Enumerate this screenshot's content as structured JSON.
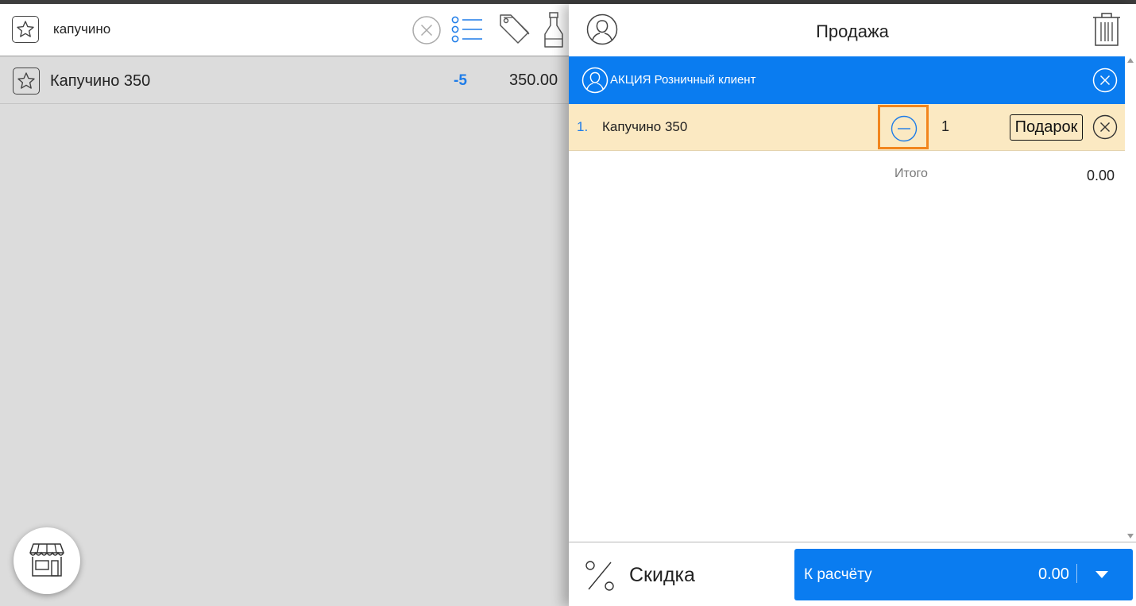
{
  "search": {
    "query": "капучино",
    "icons": [
      "star-icon",
      "clear-icon",
      "list-view-icon",
      "price-tag-icon",
      "bottle-icon"
    ]
  },
  "products": [
    {
      "name": "Капучино 350",
      "stock": "-5",
      "price": "350.00"
    }
  ],
  "sale": {
    "title": "Продажа",
    "client": "АКЦИЯ Розничный клиент",
    "items": [
      {
        "num": "1.",
        "name": "Капучино 350",
        "qty": "1",
        "gift_label": "Подарок"
      }
    ],
    "total_label": "Итого",
    "total_value": "0.00"
  },
  "footer": {
    "discount_label": "Скидка",
    "pay_label": "К расчёту",
    "pay_amount": "0.00"
  },
  "colors": {
    "accent": "#0a7cf0",
    "item_highlight": "#fbe9c2",
    "focus_outline": "#f2851d",
    "stock_negative": "#1e7ce8",
    "left_background": "#dcdcdc"
  }
}
